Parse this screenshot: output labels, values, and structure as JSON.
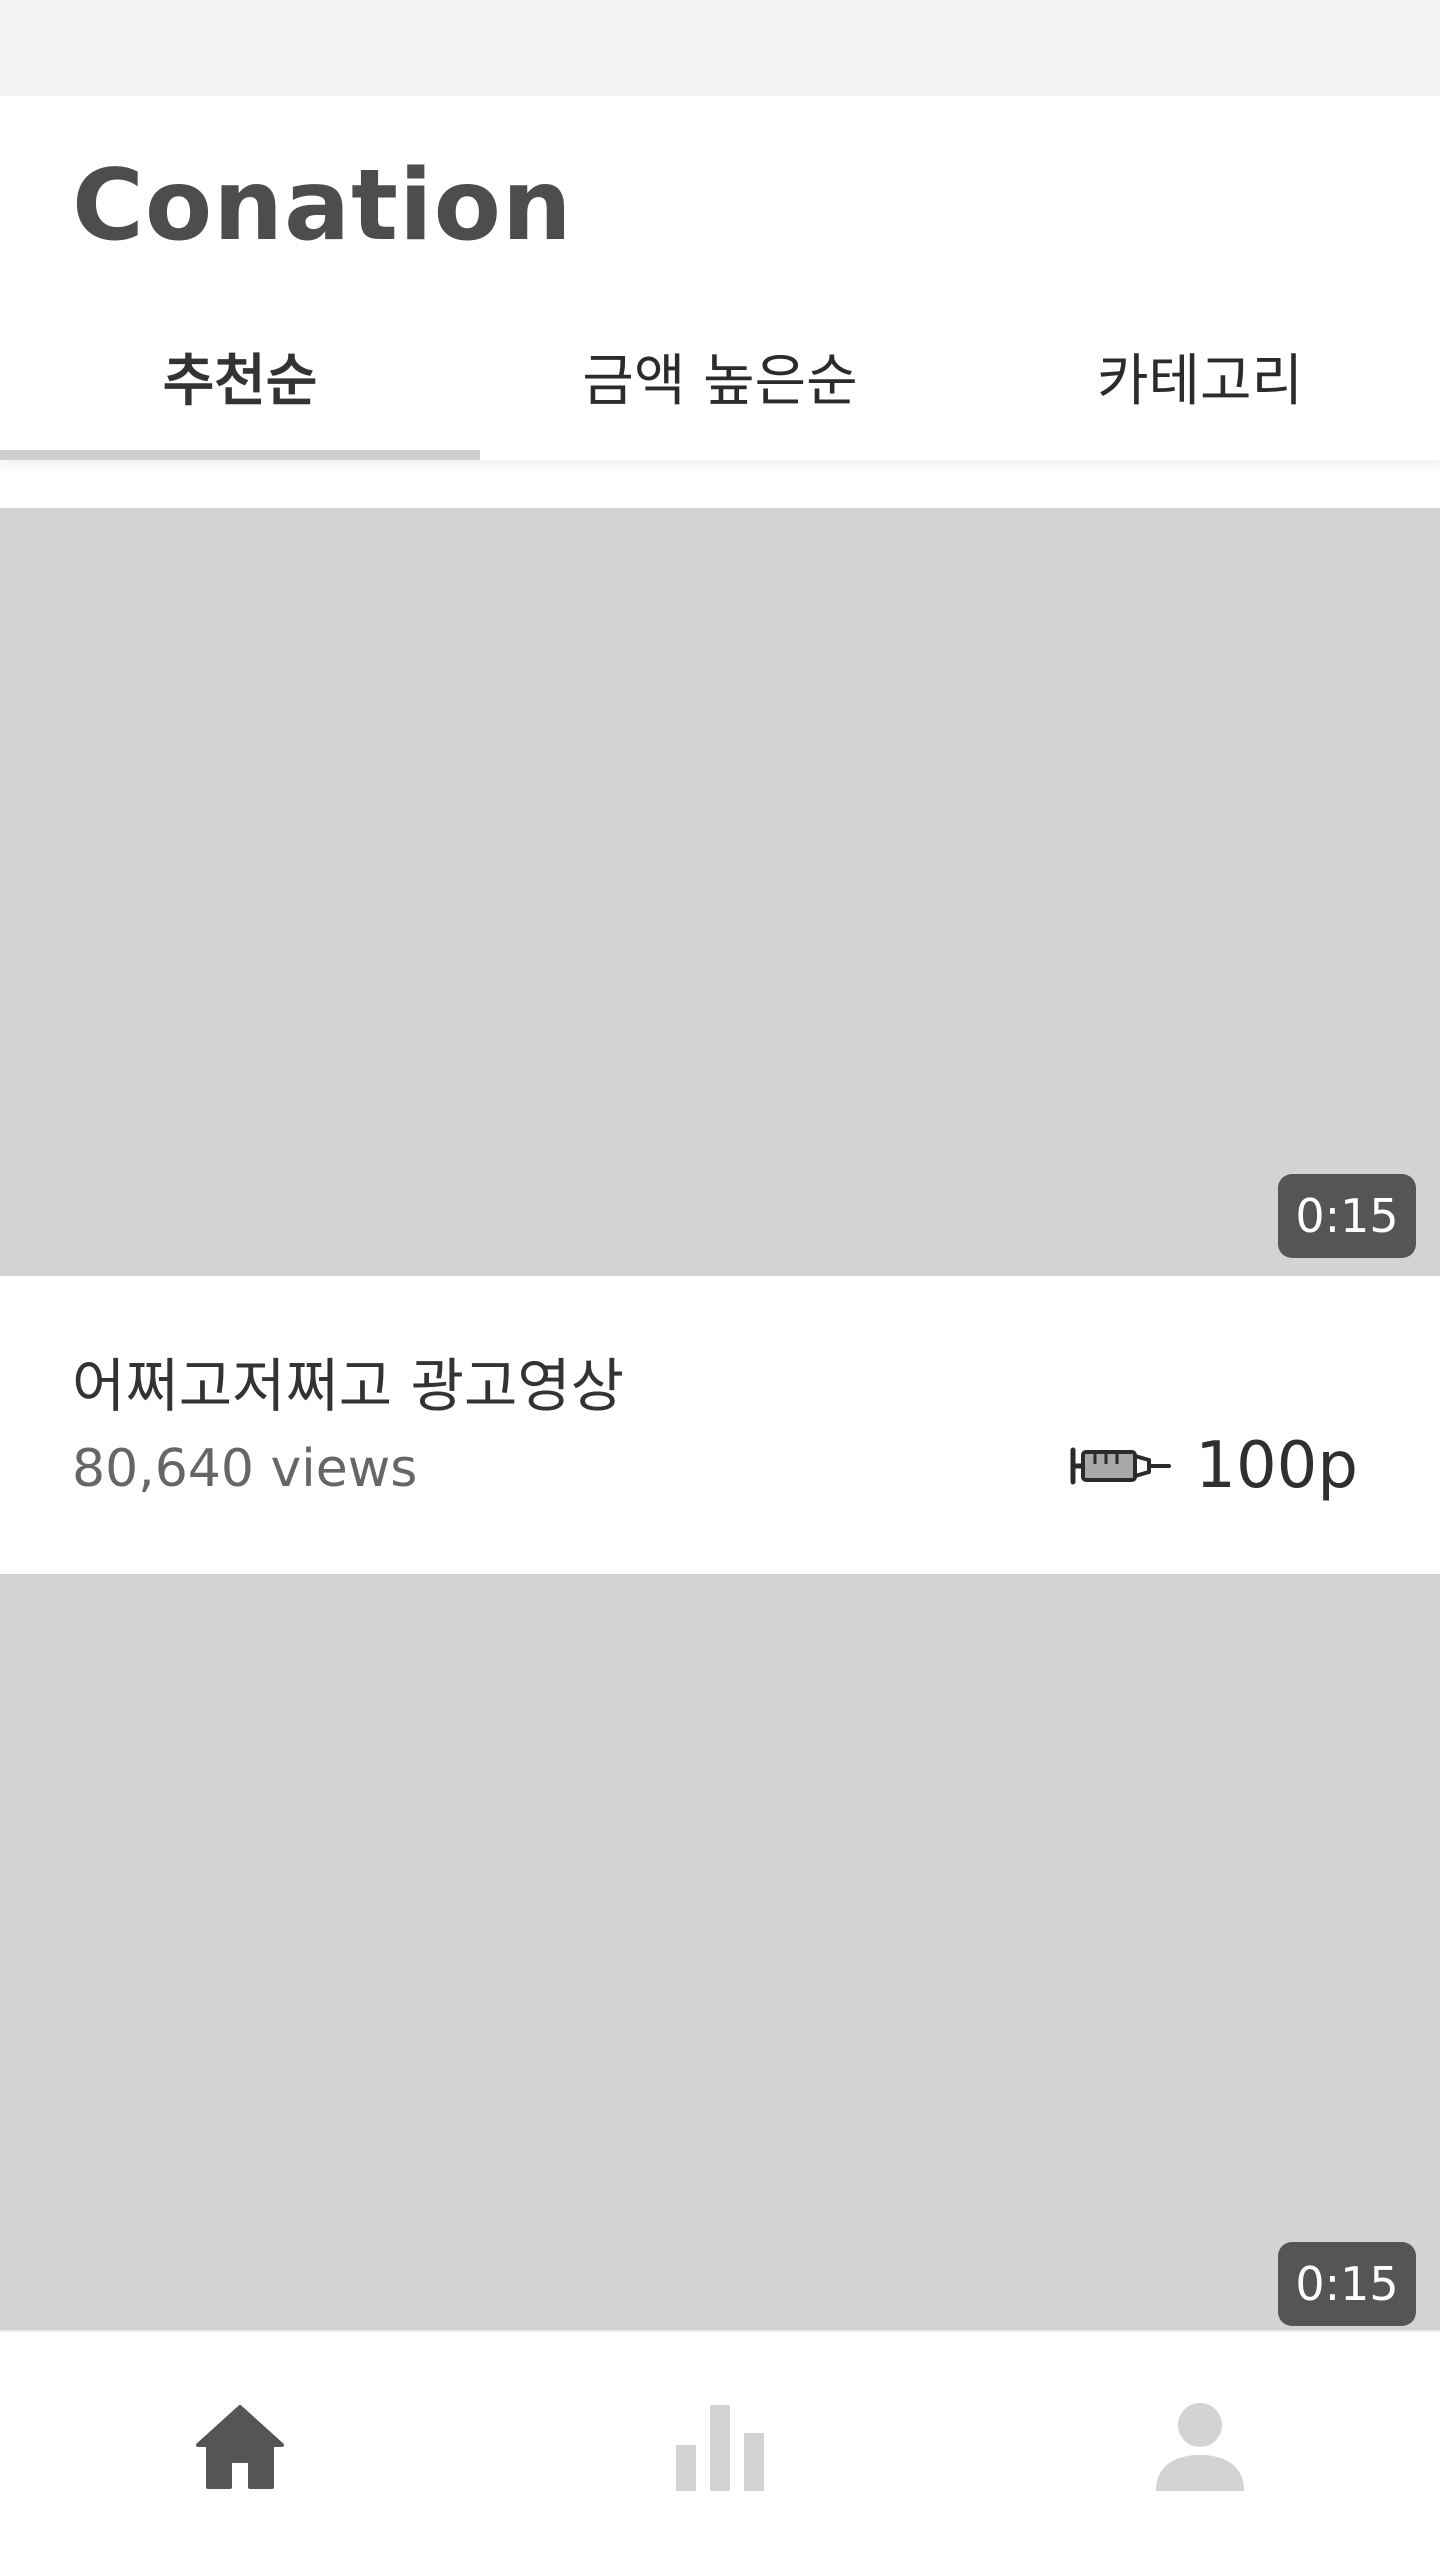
{
  "app": {
    "title": "Conation"
  },
  "tabs": [
    {
      "label": "추천순",
      "active": true
    },
    {
      "label": "금액 높은순",
      "active": false
    },
    {
      "label": "카테고리",
      "active": false
    }
  ],
  "feed": {
    "items": [
      {
        "duration": "0:15",
        "title": "어쩌고저쩌고 광고영상",
        "views": "80,640 views",
        "points": "100p",
        "points_icon": "syringe-icon"
      },
      {
        "duration": "0:15"
      }
    ]
  },
  "bottom_nav": [
    {
      "icon": "home-icon",
      "active": true
    },
    {
      "icon": "bar-chart-icon",
      "active": false
    },
    {
      "icon": "user-icon",
      "active": false
    }
  ],
  "colors": {
    "thumbnail": "#d3d3d3",
    "badge": "#555555",
    "nav_active": "#555555",
    "nav_inactive": "#d3d3d3",
    "tab_indicator": "#cfcfcf"
  }
}
